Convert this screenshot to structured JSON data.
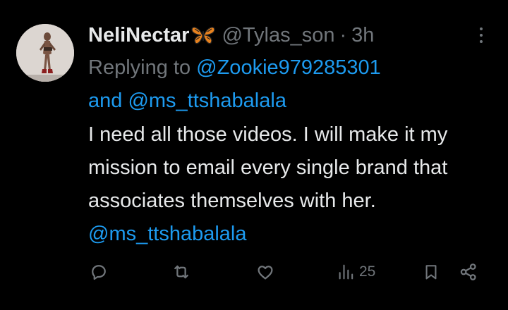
{
  "post": {
    "author": {
      "display_name": "NeliNectar",
      "emoji_icon": "butterfly-emoji",
      "handle": "@Tylas_son",
      "separator": "·",
      "timestamp": "3h"
    },
    "replying_prefix": "Replying to",
    "replying_to": [
      "@Zookie979285301",
      "@ms_ttshabalala"
    ],
    "replying_joiner": "and",
    "body": "I need all those videos. I will make it my mission to email every single brand that associates themselves with her.",
    "body_mention": "@ms_ttshabalala",
    "actions": {
      "reply_icon": "reply-icon",
      "repost_icon": "repost-icon",
      "like_icon": "heart-icon",
      "views_icon": "views-icon",
      "views_count": "25",
      "bookmark_icon": "bookmark-icon",
      "share_icon": "share-icon"
    }
  },
  "colors": {
    "background": "#000000",
    "text_primary": "#e7e9ea",
    "text_secondary": "#71767b",
    "accent": "#1d9bf0"
  }
}
